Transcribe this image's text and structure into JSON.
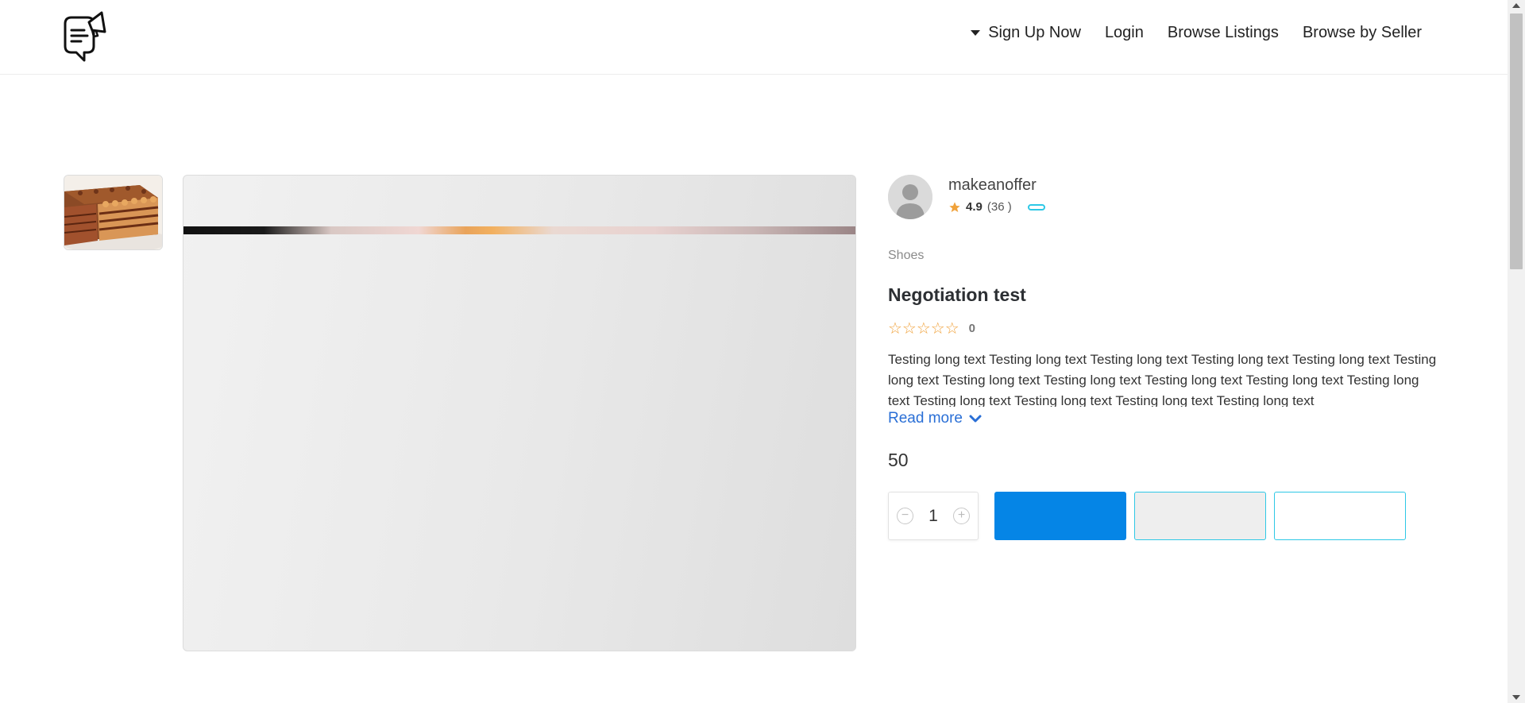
{
  "header": {
    "logo_icon": "megaphone-chat-logo-icon",
    "nav": [
      {
        "label": "Sign Up Now",
        "icon": "caret-down-icon"
      },
      {
        "label": "Login"
      },
      {
        "label": "Browse Listings"
      },
      {
        "label": "Browse by Seller"
      }
    ]
  },
  "gallery": {
    "thumbnail_icon": "cake-photo",
    "main_image": "product-image"
  },
  "seller": {
    "name": "makeanoffer",
    "rating": "4.9",
    "reviews": "(36 )",
    "avatar_icon": "user-avatar-icon",
    "star_icon": "star-icon"
  },
  "product": {
    "category": "Shoes",
    "title": "Negotiation test",
    "stars": "☆☆☆☆☆",
    "rating_count": "0",
    "description": "Testing long text Testing long text Testing long text Testing long text Testing long text Testing long text Testing long text Testing long text Testing long text Testing long text Testing long text Testing long text Testing long text Testing long text Testing long text",
    "read_more": "Read more",
    "price": "50"
  },
  "purchase": {
    "quantity": "1",
    "minus_icon": "minus-circle-icon",
    "plus_icon": "plus-circle-icon"
  },
  "colors": {
    "primary": "#0585e6",
    "accent": "#2ec8e6",
    "link": "#2a6fd6",
    "star": "#f0a23b"
  }
}
